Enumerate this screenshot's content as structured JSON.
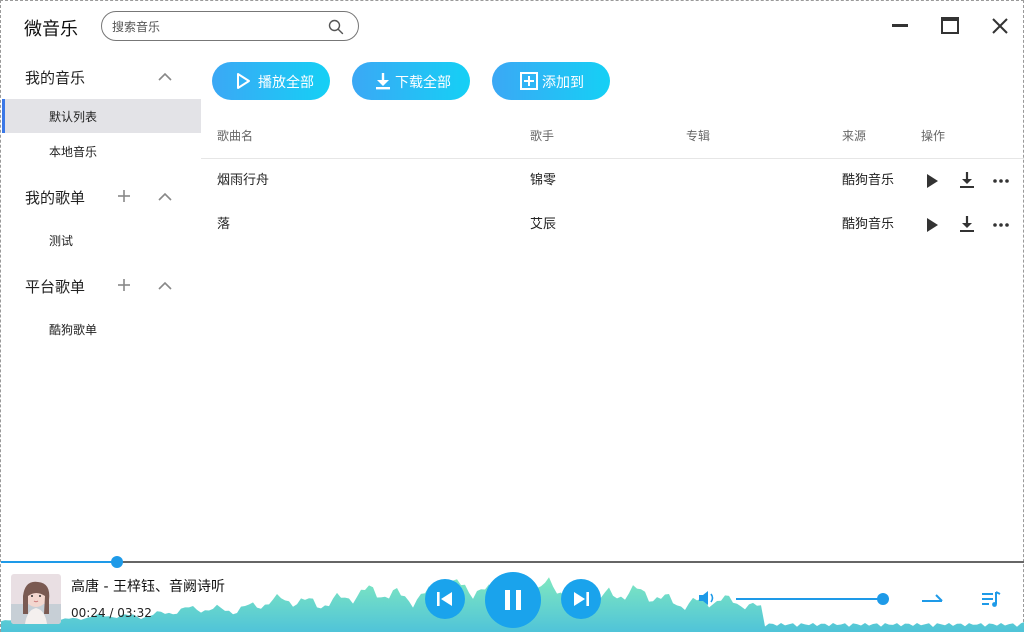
{
  "app": {
    "title": "微音乐"
  },
  "search": {
    "placeholder": "搜索音乐"
  },
  "sidebar": {
    "sections": [
      {
        "label": "我的音乐",
        "items": [
          "默认列表",
          "本地音乐"
        ]
      },
      {
        "label": "我的歌单",
        "items": [
          "测试"
        ]
      },
      {
        "label": "平台歌单",
        "items": [
          "酷狗歌单"
        ]
      }
    ],
    "active_item": "默认列表"
  },
  "toolbar": {
    "play_all": "播放全部",
    "download_all": "下载全部",
    "add_to": "添加到"
  },
  "table": {
    "headers": {
      "name": "歌曲名",
      "singer": "歌手",
      "album": "专辑",
      "source": "来源",
      "actions": "操作"
    },
    "rows": [
      {
        "name": "烟雨行舟",
        "singer": "锦零",
        "album": "",
        "source": "酷狗音乐"
      },
      {
        "name": "落",
        "singer": "艾辰",
        "album": "",
        "source": "酷狗音乐"
      }
    ]
  },
  "player": {
    "title": "高唐 - 王梓钰、音阙诗听",
    "time": "00:24 / 03:32",
    "progress_fraction": 0.113,
    "volume_fraction": 1.0,
    "accent_color": "#1e9ae8",
    "wave_colors": [
      "#7fe7c0",
      "#4fc3d9"
    ],
    "state": "playing"
  },
  "icons": {
    "search": "search-icon",
    "minimize": "minimize-icon",
    "maximize": "maximize-icon",
    "close": "close-icon",
    "collapse": "chevron-up-icon",
    "add": "plus-icon",
    "play": "play-icon",
    "download": "download-icon",
    "more": "more-icon",
    "prev": "previous-icon",
    "pause": "pause-icon",
    "next": "next-icon",
    "volume": "volume-icon",
    "mode": "sequential-mode-icon",
    "playlist": "playlist-icon"
  }
}
